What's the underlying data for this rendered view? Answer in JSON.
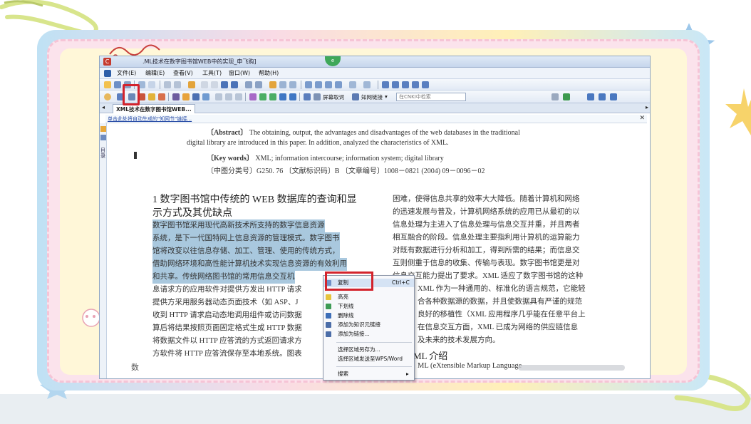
{
  "window": {
    "title": ".ML技术在数字图书馆WEB中的实现_申飞购]",
    "globe_badge": "e"
  },
  "menus": [
    "文件(E)",
    "编辑(E)",
    "查看(V)",
    "工具(T)",
    "窗口(W)",
    "帮助(H)"
  ],
  "toolbar": {
    "search_word": "屏幕取词",
    "knowledge_link": "知网链接",
    "cnki_search": "在CNKI中检索"
  },
  "tab": {
    "label": "XML技术在数字图书馆WEB..."
  },
  "link_bar": {
    "text": "单击此处将自动生成的\"知网节\"链接..."
  },
  "side_panel": {
    "label": "目录"
  },
  "abstract": {
    "en_label": "〔Abstract〕",
    "en_line1": "The obtaining, output, the advantages and disadvantages of the web databases in the traditional",
    "en_line2": "digital library are introduced in this paper. In addition, analyzed the characteristics of XML.",
    "kw_label": "〔Key words〕",
    "kw_text": "XML; information intercourse; information system; digital library",
    "class_line": "〔中图分类号〕G250. 76   〔文献标识码〕B   〔文章编号〕1008－0821 (2004) 09－0096－02"
  },
  "body": {
    "heading1_line1": "1  数字图书馆中传统的 WEB 数据库的查询和显",
    "heading1_line2": "示方式及其优缺点",
    "left_lines": [
      "    数字图书馆采用现代高新技术所支持的数字信息资源",
      "系统，是下一代国特网上信息资源的管理模式。数字图书",
      "馆将改变以往信息存储、加工、管理、使用的传统方式，",
      "借助网络环境和高性能计算机技术实现信息资源的有效利用",
      "和共享。传统网络图书馆的常用信息交互机",
      "息请求方的应用软件对提供方发出 HTTP 请求",
      "提供方采用服务器动态页面技术（如 ASP、J",
      "收到 HTTP 请求启动态地调用组件或访问数据",
      "算后将结果按照页面固定格式生成 HTTP 数据",
      "将数据文件以 HTTP 应答流的方式返回请求方",
      "方软件将 HTTP 应答流保存至本地系统。图表"
    ],
    "right_lines": [
      "困难，使得信息共享的效率大大降低。随着计算机和网络",
      "的迅速发展与普及，计算机网络系统的应用已从最初的以",
      "信息处理为主进入了信息处理与信息交互并重，并且两者",
      "相互融合的阶段。信息处理主要指利用计算机的运算能力",
      "对既有数据进行分析和加工，得到所需的结果；而信息交",
      "互则侧重于信息的收集、传输与表现。数字图书馆更是对",
      "信息交互能力提出了要求。XML 适应了数字图书馆的这种",
      "XML 作为一种通用的、标准化的语言规范，它能轻",
      "合各种数据源的数据，并且使数据具有严谨的规范",
      "良好的移植性（XML 应用程序几乎能在任意平台上",
      "在信息交互方面，XML 已成为网络的供应链信息",
      "及未来的技术发展方向。"
    ],
    "heading2": "ML 介绍",
    "last_right_line": "ML (eXtensible Markup Language",
    "bottom_left_char": "数"
  },
  "context_menu": {
    "items": [
      {
        "label": "复制",
        "shortcut": "Ctrl+C"
      },
      {
        "label": "高亮",
        "shortcut": ""
      },
      {
        "label": "下划线",
        "shortcut": ""
      },
      {
        "label": "删除线",
        "shortcut": ""
      },
      {
        "label": "添加为知识元链接",
        "shortcut": ""
      },
      {
        "label": "添加为链接...",
        "shortcut": ""
      },
      {
        "label": "选择区域另存为...",
        "shortcut": ""
      },
      {
        "label": "选择区域发送至WPS/Word",
        "shortcut": ""
      },
      {
        "label": "搜索",
        "shortcut": "▸"
      }
    ]
  },
  "colors": {
    "highlight_red": "#d3232c",
    "selection": "#a9c8de",
    "frame_pink": "#fbe3ec",
    "frame_yellow": "#fff7d8"
  }
}
